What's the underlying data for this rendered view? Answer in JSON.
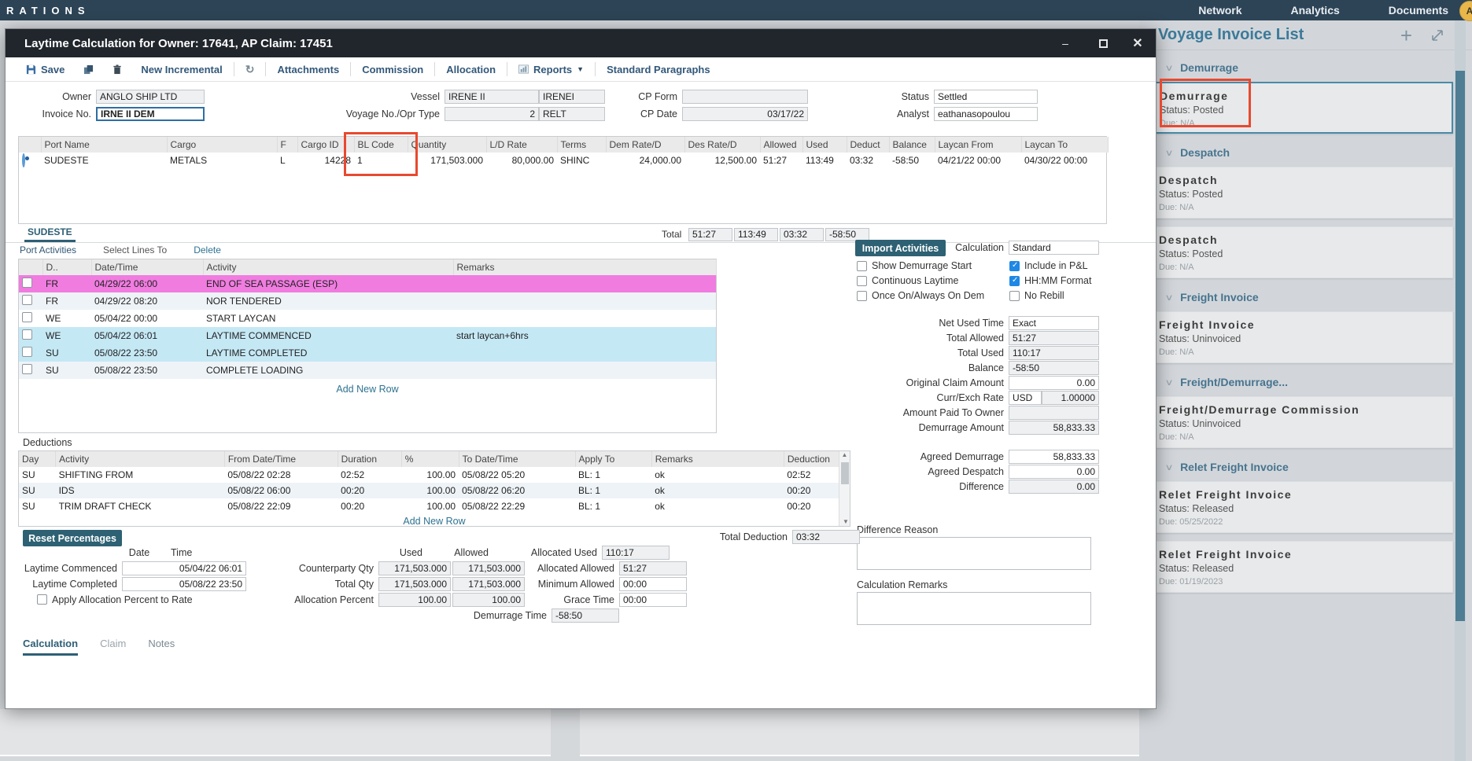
{
  "topbar": {
    "brand": "RATIONS",
    "menu": [
      "Network",
      "Analytics",
      "Documents"
    ],
    "avatar_letter": "A"
  },
  "dialog": {
    "title": "Laytime Calculation for Owner: 17641, AP Claim: 17451",
    "toolbar": {
      "save": "Save",
      "new_incremental": "New Incremental",
      "attachments": "Attachments",
      "commission": "Commission",
      "allocation": "Allocation",
      "reports": "Reports",
      "standard_paragraphs": "Standard Paragraphs"
    },
    "form": {
      "owner_label": "Owner",
      "owner": "ANGLO SHIP LTD",
      "invoice_no_label": "Invoice No.",
      "invoice_no": "IRNE II DEM",
      "vessel_label": "Vessel",
      "vessel": "IRENE II",
      "vessel_code": "IRENEI",
      "voyage_label": "Voyage No./Opr Type",
      "voyage_no": "2",
      "opr_type": "RELT",
      "cp_form_label": "CP Form",
      "cp_form": "",
      "cp_date_label": "CP Date",
      "cp_date": "03/17/22",
      "status_label": "Status",
      "status": "Settled",
      "analyst_label": "Analyst",
      "analyst": "eathanasopoulou"
    },
    "cargo_table": {
      "headers": {
        "port_name": "Port Name",
        "cargo": "Cargo",
        "f": "F",
        "cargo_id": "Cargo ID",
        "bl_code": "BL Code",
        "quantity": "Quantity",
        "ld_rate": "L/D Rate",
        "terms": "Terms",
        "dem_rate": "Dem Rate/D",
        "des_rate": "Des Rate/D",
        "allowed": "Allowed",
        "used": "Used",
        "deduct": "Deduct",
        "balance": "Balance",
        "laycan_from": "Laycan From",
        "laycan_to": "Laycan To"
      },
      "row": {
        "port_name": "SUDESTE",
        "cargo": "METALS",
        "f": "L",
        "cargo_id": "14228",
        "bl_code": "1",
        "quantity": "171,503.000",
        "ld_rate": "80,000.00",
        "terms": "SHINC",
        "dem_rate": "24,000.00",
        "des_rate": "12,500.00",
        "allowed": "51:27",
        "used": "113:49",
        "deduct": "03:32",
        "balance": "-58:50",
        "laycan_from": "04/21/22 00:00",
        "laycan_to": "04/30/22 00:00"
      },
      "total_label": "Total",
      "totals": {
        "allowed": "51:27",
        "used": "113:49",
        "deduct": "03:32",
        "balance": "-58:50"
      }
    },
    "port_tab": "SUDESTE",
    "port_activities": {
      "title": "Port Activities",
      "select_lines_to": "Select Lines To",
      "delete_link": "Delete",
      "headers": {
        "day": "D..",
        "datetime": "Date/Time",
        "activity": "Activity",
        "remarks": "Remarks"
      },
      "rows": [
        {
          "day": "FR",
          "datetime": "04/29/22 06:00",
          "activity": "END OF SEA PASSAGE (ESP)",
          "remarks": ""
        },
        {
          "day": "FR",
          "datetime": "04/29/22 08:20",
          "activity": "NOR TENDERED",
          "remarks": ""
        },
        {
          "day": "WE",
          "datetime": "05/04/22 00:00",
          "activity": "START LAYCAN",
          "remarks": ""
        },
        {
          "day": "WE",
          "datetime": "05/04/22 06:01",
          "activity": "LAYTIME COMMENCED",
          "remarks": "start laycan+6hrs"
        },
        {
          "day": "SU",
          "datetime": "05/08/22 23:50",
          "activity": "LAYTIME COMPLETED",
          "remarks": ""
        },
        {
          "day": "SU",
          "datetime": "05/08/22 23:50",
          "activity": "COMPLETE LOADING",
          "remarks": ""
        }
      ],
      "add_new_row": "Add New Row"
    },
    "calc_panel": {
      "import_activities": "Import Activities",
      "calculation_label": "Calculation",
      "calculation": "Standard",
      "cb_show_demurrage": "Show Demurrage Start",
      "cb_continuous": "Continuous Laytime",
      "cb_once_on": "Once On/Always On Dem",
      "cb_include_pl": "Include in P&L",
      "cb_hhmm": "HH:MM Format",
      "cb_no_rebill": "No Rebill",
      "net_used_time_label": "Net Used Time",
      "net_used_time": "Exact",
      "total_allowed_label": "Total Allowed",
      "total_allowed": "51:27",
      "total_used_label": "Total Used",
      "total_used": "110:17",
      "balance_label": "Balance",
      "balance": "-58:50",
      "original_claim_label": "Original Claim Amount",
      "original_claim": "0.00",
      "curr_label": "Curr/Exch Rate",
      "currency": "USD",
      "exch_rate": "1.00000",
      "amount_paid_label": "Amount Paid To Owner",
      "amount_paid": "",
      "demurrage_amount_label": "Demurrage Amount",
      "demurrage_amount": "58,833.33",
      "agreed_demurrage_label": "Agreed Demurrage",
      "agreed_demurrage": "58,833.33",
      "agreed_despatch_label": "Agreed Despatch",
      "agreed_despatch": "0.00",
      "difference_label": "Difference",
      "difference": "0.00",
      "difference_reason_label": "Difference Reason",
      "calculation_remarks_label": "Calculation Remarks"
    },
    "deductions": {
      "title": "Deductions",
      "headers": {
        "day": "Day",
        "activity": "Activity",
        "from": "From Date/Time",
        "duration": "Duration",
        "pct": "%",
        "to": "To Date/Time",
        "apply_to": "Apply To",
        "remarks": "Remarks",
        "deduction": "Deduction"
      },
      "rows": [
        {
          "day": "SU",
          "activity": "SHIFTING FROM",
          "from": "05/08/22 02:28",
          "duration": "02:52",
          "pct": "100.00",
          "to": "05/08/22 05:20",
          "apply_to": "BL: 1",
          "remarks": "ok",
          "deduction": "02:52"
        },
        {
          "day": "SU",
          "activity": "IDS",
          "from": "05/08/22 06:00",
          "duration": "00:20",
          "pct": "100.00",
          "to": "05/08/22 06:20",
          "apply_to": "BL: 1",
          "remarks": "ok",
          "deduction": "00:20"
        },
        {
          "day": "SU",
          "activity": "TRIM DRAFT CHECK",
          "from": "05/08/22 22:09",
          "duration": "00:20",
          "pct": "100.00",
          "to": "05/08/22 22:29",
          "apply_to": "BL: 1",
          "remarks": "ok",
          "deduction": "00:20"
        }
      ],
      "add_new_row": "Add New Row",
      "reset_percentages": "Reset Percentages",
      "total_deduction_label": "Total Deduction",
      "total_deduction": "03:32"
    },
    "allocation": {
      "date_header": "Date",
      "time_header": "Time",
      "laytime_commenced_label": "Laytime Commenced",
      "laytime_commenced": "05/04/22 06:01",
      "laytime_completed_label": "Laytime Completed",
      "laytime_completed": "05/08/22 23:50",
      "apply_allocation_label": "Apply Allocation Percent to Rate",
      "used_header": "Used",
      "allowed_header": "Allowed",
      "counterparty_label": "Counterparty Qty",
      "counterparty_used": "171,503.000",
      "counterparty_allowed": "171,503.000",
      "total_qty_label": "Total Qty",
      "total_qty_used": "171,503.000",
      "total_qty_allowed": "171,503.000",
      "alloc_pct_label": "Allocation Percent",
      "alloc_pct_used": "100.00",
      "alloc_pct_allowed": "100.00",
      "allocated_used_label": "Allocated Used",
      "allocated_used": "110:17",
      "allocated_allowed_label": "Allocated Allowed",
      "allocated_allowed": "51:27",
      "minimum_allowed_label": "Minimum Allowed",
      "minimum_allowed": "00:00",
      "grace_time_label": "Grace Time",
      "grace_time": "00:00",
      "demurrage_time_label": "Demurrage Time",
      "demurrage_time": "-58:50"
    },
    "bottom_tabs": {
      "calculation": "Calculation",
      "claim": "Claim",
      "notes": "Notes"
    }
  },
  "sidebar": {
    "title": "Voyage Invoice List",
    "groups": [
      {
        "label": "Demurrage"
      },
      {
        "label": "Despatch"
      },
      {
        "label": "Freight Invoice"
      },
      {
        "label": "Freight/Demurrage..."
      },
      {
        "label": "Relet Freight Invoice"
      }
    ],
    "cards": [
      {
        "title": "Demurrage",
        "status": "Status: Posted",
        "due": "Due: N/A"
      },
      {
        "title": "Despatch",
        "status": "Status: Posted",
        "due": "Due: N/A"
      },
      {
        "title": "Despatch",
        "status": "Status: Posted",
        "due": "Due: N/A"
      },
      {
        "title": "Freight Invoice",
        "status": "Status: Uninvoiced",
        "due": "Due: N/A"
      },
      {
        "title": "Freight/Demurrage Commission",
        "status": "Status: Uninvoiced",
        "due": "Due: N/A"
      },
      {
        "title": "Relet Freight Invoice",
        "status": "Status: Released",
        "due": "Due: 05/25/2022"
      },
      {
        "title": "Relet Freight Invoice",
        "status": "Status: Released",
        "due": "Due: 01/19/2023"
      }
    ]
  },
  "colors": {
    "accent_teal": "#2d6173",
    "annotation_red": "#e8492f",
    "checked_blue": "#1e88e5",
    "highlight_pink": "#f07ce0",
    "highlight_blue": "#c5e8f5"
  }
}
